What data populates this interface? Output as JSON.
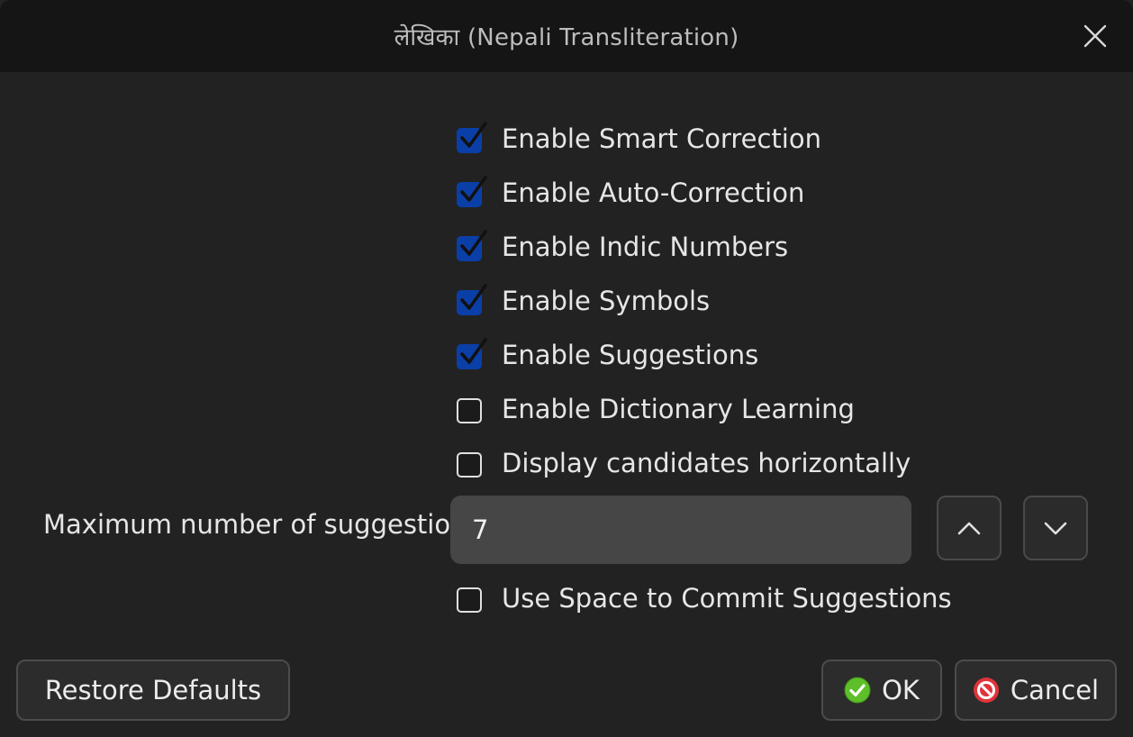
{
  "window": {
    "title": "लेखिका (Nepali Transliteration)"
  },
  "options": [
    {
      "label": "Enable Smart Correction",
      "checked": true
    },
    {
      "label": "Enable Auto-Correction",
      "checked": true
    },
    {
      "label": "Enable Indic Numbers",
      "checked": true
    },
    {
      "label": "Enable Symbols",
      "checked": true
    },
    {
      "label": "Enable Suggestions",
      "checked": true
    },
    {
      "label": "Enable Dictionary Learning",
      "checked": false
    },
    {
      "label": "Display candidates horizontally",
      "checked": false
    }
  ],
  "suggestions": {
    "label": "Maximum number of suggestions:",
    "value": "7"
  },
  "space_commit": {
    "label": "Use Space to Commit Suggestions",
    "checked": false
  },
  "buttons": {
    "restore": "Restore Defaults",
    "ok": "OK",
    "cancel": "Cancel"
  },
  "colors": {
    "checked_fill": "#0b3fa8",
    "titlebar": "#151515",
    "background": "#222222",
    "ok_icon": "#5fbf2a",
    "cancel_icon": "#e0343a"
  },
  "icons": {
    "close": "close-icon",
    "up": "chevron-up-icon",
    "down": "chevron-down-icon",
    "ok": "check-circle-icon",
    "cancel": "no-entry-icon"
  }
}
